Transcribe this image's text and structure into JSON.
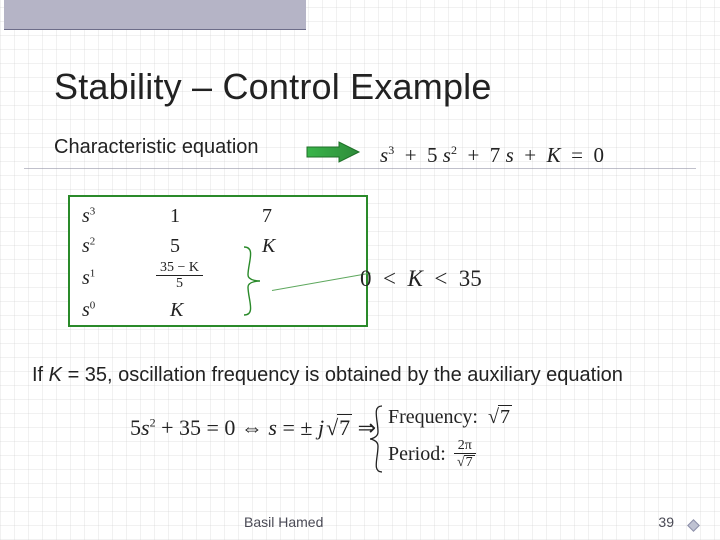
{
  "slide": {
    "title": "Stability – Control Example",
    "subtitle": "Characteristic equation",
    "char_eq": {
      "text": "s³ + 5 s² + 7 s + K = 0"
    },
    "routh": {
      "rows": [
        {
          "label": "s³",
          "c1": "1",
          "c2": "7"
        },
        {
          "label": "s²",
          "c1": "5",
          "c2": "K"
        },
        {
          "label": "s¹",
          "c1_frac": {
            "num": "35 − K",
            "den": "5"
          },
          "c2": ""
        },
        {
          "label": "s⁰",
          "c1": "K",
          "c2": ""
        }
      ]
    },
    "k_range": "0 < K < 35",
    "if_line_prefix": "If ",
    "if_line_var": "K",
    "if_line_rest": " = 35, oscillation frequency is obtained by the auxiliary equation",
    "aux": {
      "lhs": "5s² + 35 = 0 ⇔ s = ± j",
      "sqrt_val": "7",
      "implies": " ⇒ "
    },
    "freq_period": {
      "freq_label": "Frequency:",
      "freq_sqrt": "7",
      "period_label": "Period:",
      "period_frac": {
        "num": "2π",
        "den_sqrt": "7"
      }
    },
    "footer": {
      "author": "Basil Hamed",
      "page": "39"
    }
  }
}
